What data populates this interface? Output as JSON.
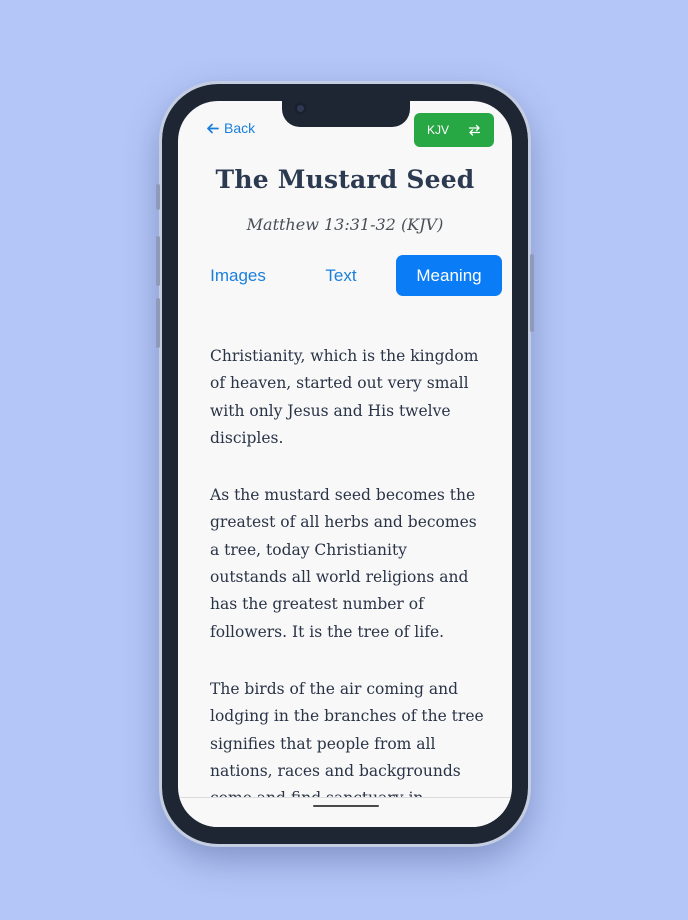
{
  "header": {
    "back_label": "Back",
    "back_icon": "arrow-left-icon",
    "version_label": "KJV",
    "version_icon": "swap-icon"
  },
  "passage": {
    "title": "The Mustard Seed",
    "reference": "Matthew 13:31-32 (KJV)"
  },
  "tabs": [
    {
      "label": "Images",
      "active": false
    },
    {
      "label": "Text",
      "active": false
    },
    {
      "label": "Meaning",
      "active": true
    }
  ],
  "content": {
    "paragraphs": [
      "Christianity, which is the kingdom of heaven, started out very small with only Jesus and His twelve disciples.",
      "As the mustard seed becomes the greatest of all herbs and becomes a tree, today Christianity outstands all world religions and has the greatest number of followers. It is the tree of life.",
      "The birds of the air coming and lodging in the branches of the tree signifies that people from all nations, races and backgrounds come and find sanctuary in"
    ]
  },
  "colors": {
    "background": "#b4c6f7",
    "accent_blue": "#0a7cf5",
    "link_blue": "#1a7fdc",
    "version_green": "#28a745",
    "title_text": "#2b3a50"
  }
}
